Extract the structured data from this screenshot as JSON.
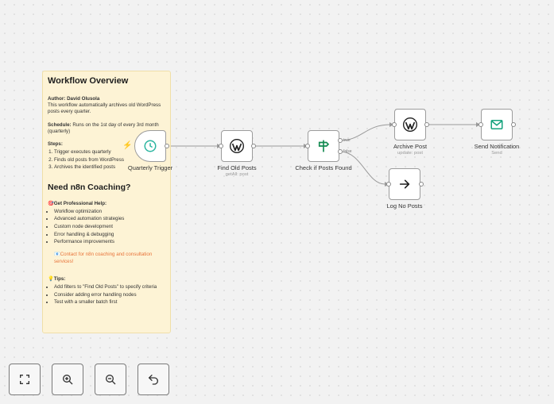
{
  "sticky": {
    "title": "Workflow Overview",
    "author_label": "Author:",
    "author": "David Olusola",
    "description": "This workflow automatically archives old WordPress posts every quarter.",
    "schedule_label": "Schedule:",
    "schedule": "Runs on the 1st day of every 3rd month (quarterly)",
    "steps_label": "Steps:",
    "steps": [
      "Trigger executes quarterly",
      "Finds old posts from WordPress",
      "Archives the identified posts"
    ],
    "coaching_title": "Need n8n Coaching?",
    "help_label": "🎯Get Professional Help:",
    "help_items": [
      "Workflow optimization",
      "Advanced automation strategies",
      "Custom node development",
      "Error handling & debugging",
      "Performance improvements"
    ],
    "contact": "📧Contact for n8n coaching and consultation services!",
    "tips_label": "💡Tips:",
    "tips": [
      "Add filters to \"Find Old Posts\" to specify criteria",
      "Consider adding error handling nodes",
      "Test with a smaller batch first"
    ]
  },
  "nodes": {
    "trigger": {
      "label": "Quarterly Trigger"
    },
    "find": {
      "label": "Find Old Posts",
      "sub": "getAll: post"
    },
    "check": {
      "label": "Check if Posts Found",
      "true_label": "true",
      "false_label": "false"
    },
    "archive": {
      "label": "Archive Post",
      "sub": "update: post"
    },
    "notify": {
      "label": "Send Notification",
      "sub": "Send"
    },
    "log": {
      "label": "Log No Posts"
    }
  },
  "colors": {
    "trigger_icon": "#2bb5a0",
    "wordpress_icon": "#1f1f1f",
    "if_icon": "#128a50",
    "mail_icon": "#16a37e",
    "accent": "#ef6b4f"
  },
  "icons": {
    "trigger": "clock-icon",
    "wordpress": "wordpress-icon",
    "if": "signpost-icon",
    "mail": "envelope-icon",
    "noop": "arrow-right-icon"
  },
  "controls": [
    "fit-view",
    "zoom-in",
    "zoom-out",
    "reset-zoom"
  ]
}
